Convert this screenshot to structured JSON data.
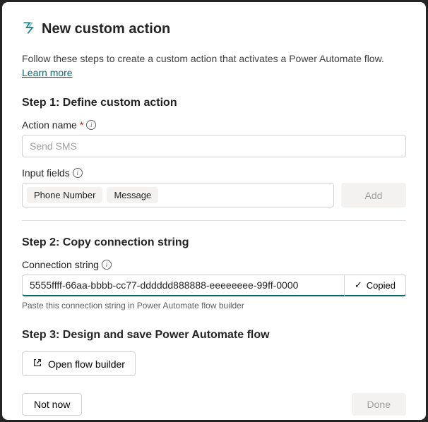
{
  "header": {
    "title": "New custom action"
  },
  "intro": {
    "text_before": "Follow these steps to create a custom action that activates a Power Automate flow. ",
    "link_text": "Learn more"
  },
  "step1": {
    "title": "Step 1: Define custom action",
    "action_name_label": "Action name",
    "action_name_placeholder": "Send SMS",
    "input_fields_label": "Input fields",
    "tags": [
      "Phone Number",
      "Message"
    ],
    "add_button": "Add"
  },
  "step2": {
    "title": "Step 2: Copy connection string",
    "conn_label": "Connection string",
    "conn_value": "5555ffff-66aa-bbbb-cc77-dddddd888888-eeeeeeee-99ff-0000",
    "copied_label": "Copied",
    "hint": "Paste this connection string in Power Automate flow builder"
  },
  "step3": {
    "title": "Step 3: Design and save Power Automate flow",
    "open_flow_label": "Open flow builder"
  },
  "footer": {
    "not_now": "Not now",
    "done": "Done"
  }
}
